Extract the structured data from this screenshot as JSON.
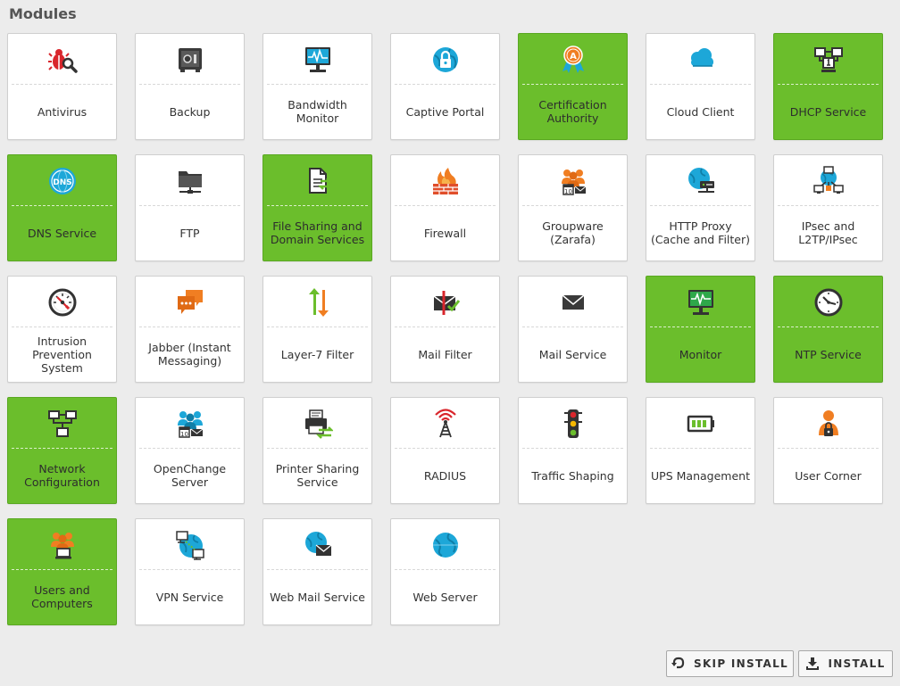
{
  "page": {
    "title": "Modules"
  },
  "colors": {
    "selected_tile": "#6bbe2c",
    "tile": "#ffffff",
    "background": "#ececec"
  },
  "modules": [
    {
      "label": "Antivirus",
      "icon": "bug-magnifier-icon",
      "selected": false
    },
    {
      "label": "Backup",
      "icon": "safe-icon",
      "selected": false
    },
    {
      "label": "Bandwidth\nMonitor",
      "icon": "monitor-graph-icon",
      "selected": false
    },
    {
      "label": "Captive Portal",
      "icon": "globe-lock-icon",
      "selected": false
    },
    {
      "label": "Certification\nAuthority",
      "icon": "certificate-ribbon-icon",
      "selected": true
    },
    {
      "label": "Cloud Client",
      "icon": "cloud-icon",
      "selected": false
    },
    {
      "label": "DHCP Service",
      "icon": "network-hosts-icon",
      "selected": true
    },
    {
      "label": "DNS Service",
      "icon": "dns-globe-icon",
      "selected": true
    },
    {
      "label": "FTP",
      "icon": "folder-network-icon",
      "selected": false
    },
    {
      "label": "File Sharing and\nDomain Services",
      "icon": "file-share-icon",
      "selected": true
    },
    {
      "label": "Firewall",
      "icon": "firewall-flame-icon",
      "selected": false
    },
    {
      "label": "Groupware\n(Zarafa)",
      "icon": "groupware-people-icon",
      "selected": false
    },
    {
      "label": "HTTP Proxy\n(Cache and Filter)",
      "icon": "globe-server-icon",
      "selected": false
    },
    {
      "label": "IPsec and\nL2TP/IPsec",
      "icon": "network-globe-icon",
      "selected": false
    },
    {
      "label": "Intrusion\nPrevention\nSystem",
      "icon": "gauge-icon",
      "selected": false
    },
    {
      "label": "Jabber (Instant\nMessaging)",
      "icon": "chat-bubbles-icon",
      "selected": false
    },
    {
      "label": "Layer-7 Filter",
      "icon": "arrows-updown-icon",
      "selected": false
    },
    {
      "label": "Mail Filter",
      "icon": "mail-filter-icon",
      "selected": false
    },
    {
      "label": "Mail Service",
      "icon": "envelope-icon",
      "selected": false
    },
    {
      "label": "Monitor",
      "icon": "monitor-pulse-icon",
      "selected": true
    },
    {
      "label": "NTP Service",
      "icon": "clock-icon",
      "selected": true
    },
    {
      "label": "Network\nConfiguration",
      "icon": "network-topology-icon",
      "selected": true
    },
    {
      "label": "OpenChange\nServer",
      "icon": "people-calendar-icon",
      "selected": false
    },
    {
      "label": "Printer Sharing\nService",
      "icon": "printer-share-icon",
      "selected": false
    },
    {
      "label": "RADIUS",
      "icon": "antenna-icon",
      "selected": false
    },
    {
      "label": "Traffic Shaping",
      "icon": "traffic-light-icon",
      "selected": false
    },
    {
      "label": "UPS Management",
      "icon": "battery-icon",
      "selected": false
    },
    {
      "label": "User Corner",
      "icon": "user-lock-icon",
      "selected": false
    },
    {
      "label": "Users and\nComputers",
      "icon": "users-computer-icon",
      "selected": true
    },
    {
      "label": "VPN Service",
      "icon": "globe-vpn-icon",
      "selected": false
    },
    {
      "label": "Web Mail Service",
      "icon": "globe-mail-icon",
      "selected": false
    },
    {
      "label": "Web Server",
      "icon": "globe-icon",
      "selected": false
    }
  ],
  "buttons": {
    "skip": {
      "label": "SKIP INSTALL",
      "icon": "undo-arrow-icon"
    },
    "install": {
      "label": "INSTALL",
      "icon": "download-tray-icon"
    }
  }
}
